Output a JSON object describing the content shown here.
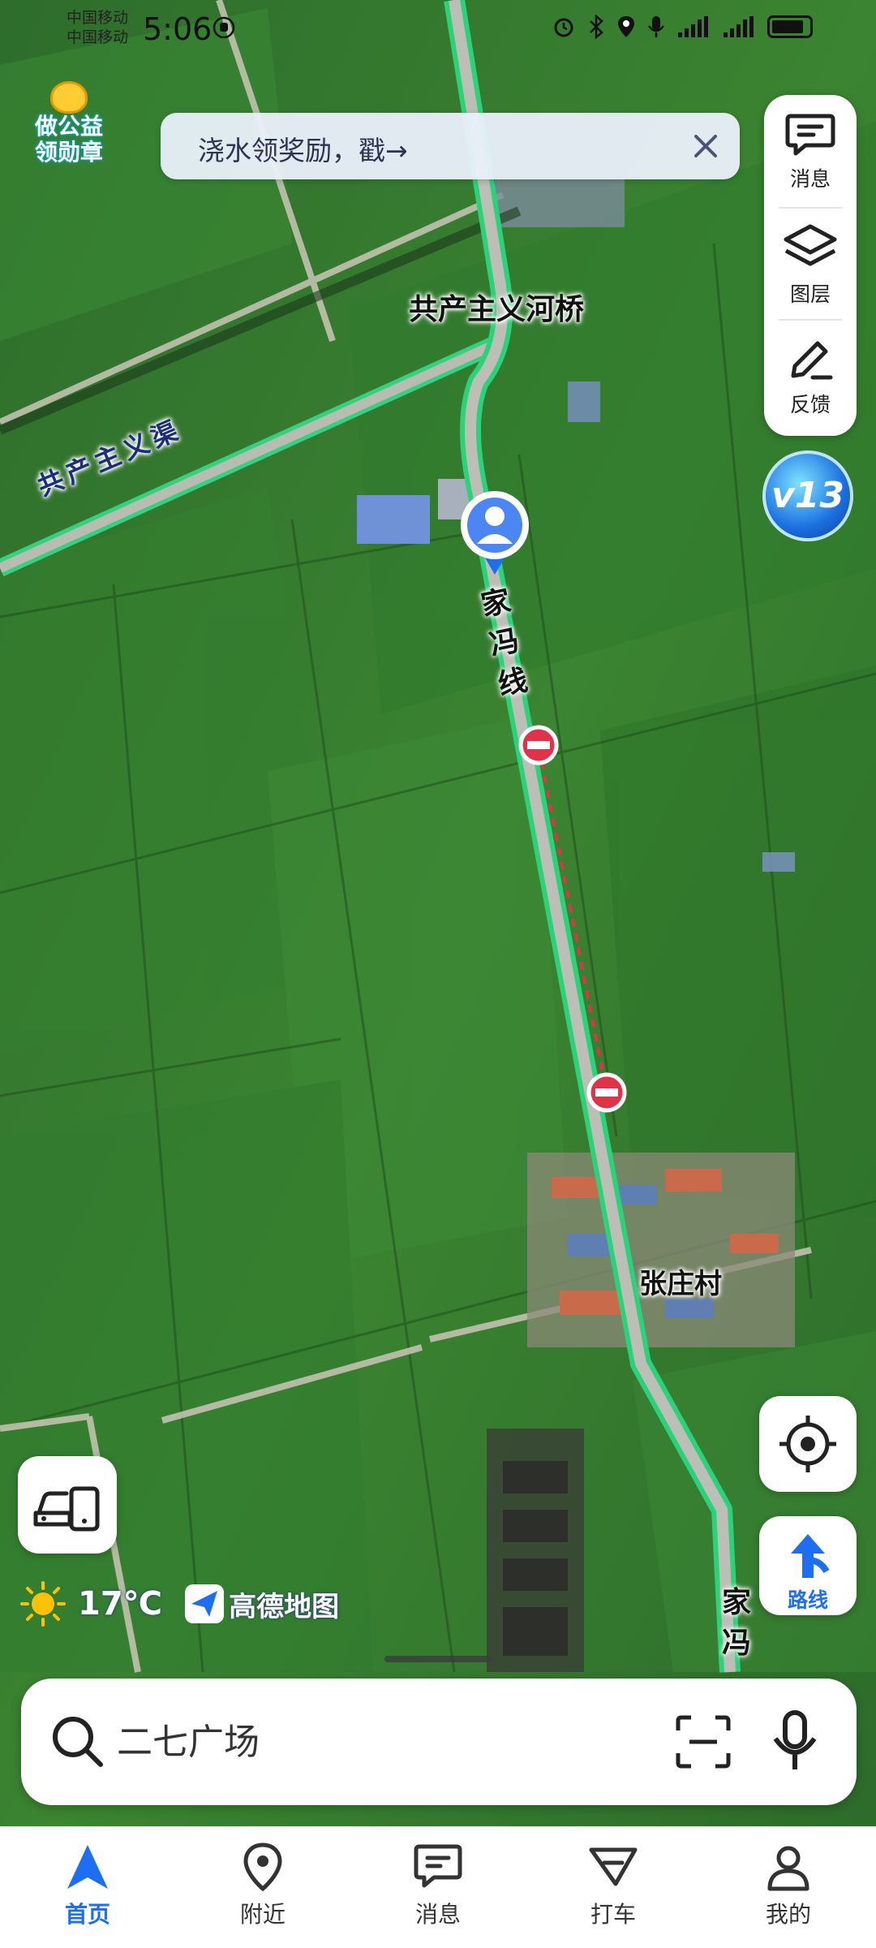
{
  "status_bar": {
    "carrier_1": "中国移动",
    "carrier_2": "中国移动",
    "time": "5:06"
  },
  "promo": {
    "badge_line_1": "做公益",
    "badge_line_2": "领勋章",
    "banner_text": "浇水领奖励，戳→"
  },
  "map": {
    "labels": {
      "bridge": "共产主义河桥",
      "canal": "共产主义渠",
      "road_a": [
        "家",
        "冯",
        "线"
      ],
      "road_b": [
        "家",
        "冯"
      ],
      "village": "张庄村"
    }
  },
  "tools": {
    "messages": "消息",
    "layers": "图层",
    "feedback": "反馈",
    "version_badge": "v13"
  },
  "controls": {
    "route_label": "路线"
  },
  "weather": {
    "temperature": "17℃",
    "brand": "高德地图"
  },
  "search": {
    "placeholder": "二七广场"
  },
  "nav": {
    "items": [
      {
        "label": "首页",
        "active": true
      },
      {
        "label": "附近",
        "active": false
      },
      {
        "label": "消息",
        "active": false
      },
      {
        "label": "打车",
        "active": false
      },
      {
        "label": "我的",
        "active": false
      }
    ]
  },
  "colors": {
    "accent": "#1d6ef0",
    "route_green": "#2ad37a",
    "field_green": "#2f7a2f"
  }
}
